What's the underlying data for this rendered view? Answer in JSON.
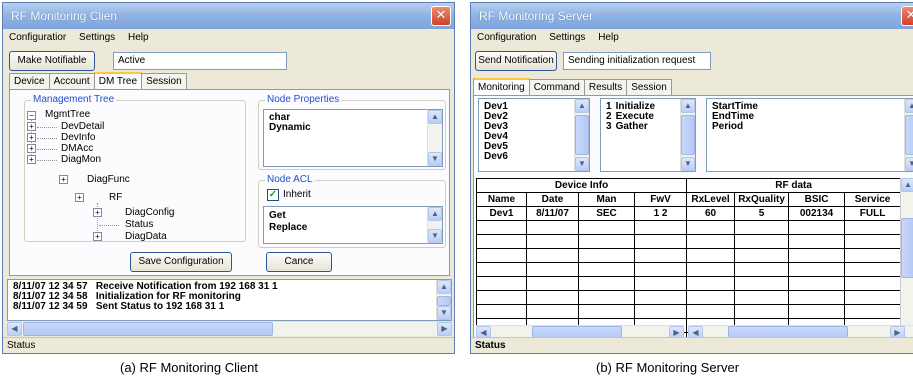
{
  "client": {
    "title": "RF Monitoring Clien",
    "menu": [
      "Configuratior",
      "Settings",
      "Help"
    ],
    "make_notifiable_label": "Make Notifiable",
    "notify_status_value": "Active",
    "tabs": [
      "Device",
      "Account",
      "DM Tree",
      "Session"
    ],
    "active_tab": "DM Tree",
    "management_tree": {
      "label": "Management Tree",
      "root": "MgmtTree",
      "children": [
        "DevDetail",
        "DevInfo",
        "DMAcc",
        "DiagMon"
      ],
      "diag_func": "DiagFunc",
      "rf": "RF",
      "rf_children": [
        "DiagConfig",
        "Status",
        "DiagData"
      ]
    },
    "node_properties": {
      "label": "Node Properties",
      "lines": [
        "char",
        "Dynamic"
      ]
    },
    "node_acl": {
      "label": "Node ACL",
      "inherit_label": "Inherit",
      "inherit_checked": true,
      "lines": [
        "Get",
        "Replace"
      ]
    },
    "save_label": "Save Configuration",
    "cancel_label": "Cance",
    "log": [
      {
        "time": "8/11/07 12 34 57",
        "msg": "Receive Notification from 192 168 31 1"
      },
      {
        "time": "8/11/07 12 34 58",
        "msg": "Initialization for RF monitoring"
      },
      {
        "time": "8/11/07 12 34 59",
        "msg": "Sent Status to 192 168 31 1"
      }
    ],
    "status": "Status",
    "caption": "(a) RF Monitoring Client"
  },
  "server": {
    "title": "RF Monitoring Server",
    "menu": [
      "Configuration",
      "Settings",
      "Help"
    ],
    "send_notification_label": "Send Notification",
    "notification_status": "Sending initialization request",
    "tabs": [
      "Monitoring",
      "Command",
      "Results",
      "Session"
    ],
    "active_tab": "Monitoring",
    "devices": [
      "Dev1",
      "Dev2",
      "Dev3",
      "Dev4",
      "Dev5",
      "Dev6"
    ],
    "commands": [
      {
        "num": "1",
        "label": "Initialize"
      },
      {
        "num": "2",
        "label": "Execute"
      },
      {
        "num": "3",
        "label": "Gather"
      }
    ],
    "times": [
      "StartTime",
      "EndTime",
      "Period"
    ],
    "table": {
      "group_headers": [
        "Device Info",
        "RF data"
      ],
      "columns": [
        "Name",
        "Date",
        "Man",
        "FwV",
        "RxLevel",
        "RxQuality",
        "BSIC",
        "Service"
      ],
      "rows": [
        [
          "Dev1",
          "8/11/07",
          "SEC",
          "1 2",
          "60",
          "5",
          "002134",
          "FULL"
        ]
      ],
      "empty_rows": 9
    },
    "status": "Status",
    "caption": "(b) RF Monitoring Server"
  }
}
